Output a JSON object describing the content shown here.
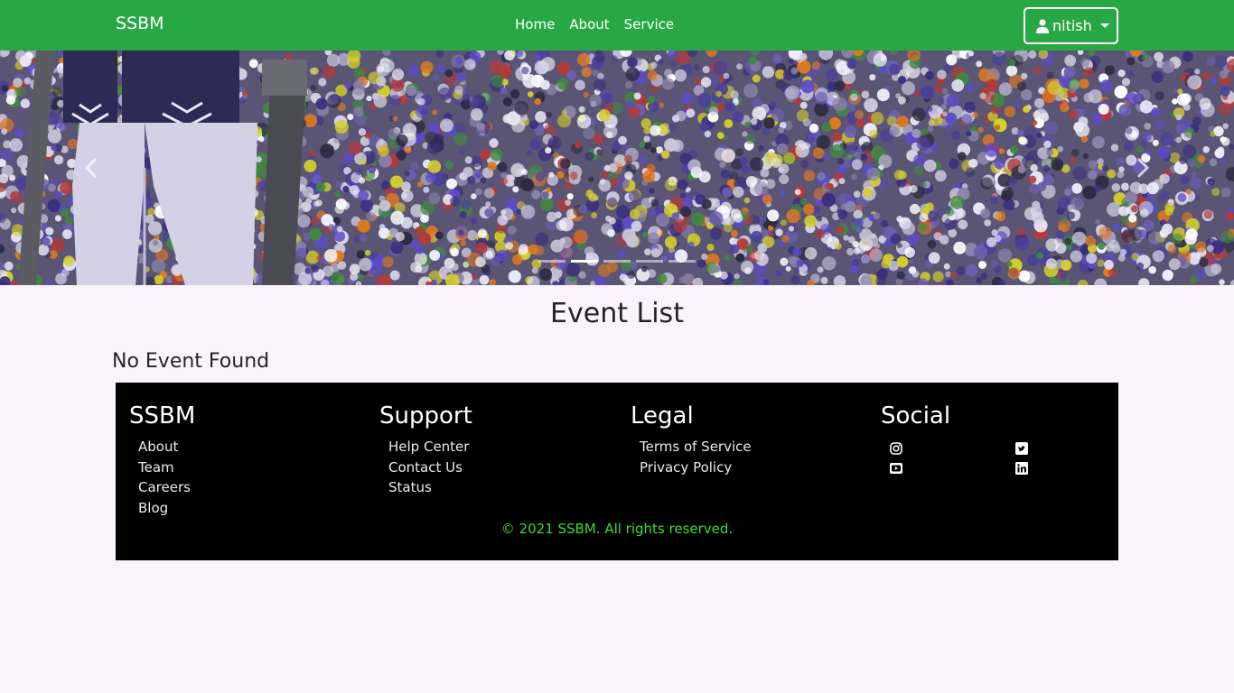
{
  "navbar": {
    "brand": "SSBM",
    "links": [
      "Home",
      "About",
      "Service"
    ],
    "user": "nitish",
    "color": "#28a745"
  },
  "carousel": {
    "indicators": 5,
    "active_index": 1,
    "prev_icon": "chevron-left-icon",
    "next_icon": "chevron-right-icon"
  },
  "main": {
    "title": "Event List",
    "empty_message": "No Event Found"
  },
  "footer": {
    "columns": [
      {
        "title": "SSBM",
        "items": [
          "About",
          "Team",
          "Careers",
          "Blog"
        ]
      },
      {
        "title": "Support",
        "items": [
          "Help Center",
          "Contact Us",
          "Status"
        ]
      },
      {
        "title": "Legal",
        "items": [
          "Terms of Service",
          "Privacy Policy"
        ]
      },
      {
        "title": "Social",
        "icons": [
          "instagram-icon",
          "twitter-icon",
          "youtube-icon",
          "linkedin-icon"
        ]
      }
    ],
    "copyright": "© 2021 SSBM. All rights reserved.",
    "copyright_color": "#3ddc35"
  }
}
